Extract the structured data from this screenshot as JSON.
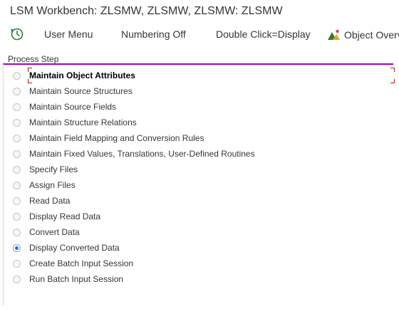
{
  "window": {
    "title": "LSM Workbench: ZLSMW, ZLSMW, ZLSMW: ZLSMW"
  },
  "toolbar": {
    "execute_icon": "execute-clock-icon",
    "user_menu_label": "User Menu",
    "numbering_label": "Numbering Off",
    "double_click_label": "Double Click=Display",
    "object_overview_label": "Object Overview",
    "object_overview_icon": "object-overview-icon"
  },
  "process_step": {
    "group_title": "Process Step",
    "accent_color": "#a100c2",
    "selected_index": 11,
    "focused_index": 0,
    "steps": [
      {
        "label": "Maintain Object Attributes",
        "selected": false
      },
      {
        "label": "Maintain Source Structures",
        "selected": false
      },
      {
        "label": "Maintain Source Fields",
        "selected": false
      },
      {
        "label": "Maintain Structure Relations",
        "selected": false
      },
      {
        "label": "Maintain Field Mapping and Conversion Rules",
        "selected": false
      },
      {
        "label": "Maintain Fixed Values, Translations, User-Defined Routines",
        "selected": false
      },
      {
        "label": "Specify Files",
        "selected": false
      },
      {
        "label": "Assign Files",
        "selected": false
      },
      {
        "label": "Read Data",
        "selected": false
      },
      {
        "label": "Display Read Data",
        "selected": false
      },
      {
        "label": "Convert Data",
        "selected": false
      },
      {
        "label": "Display Converted Data",
        "selected": true
      },
      {
        "label": "Create Batch Input Session",
        "selected": false
      },
      {
        "label": "Run Batch Input Session",
        "selected": false
      }
    ]
  }
}
